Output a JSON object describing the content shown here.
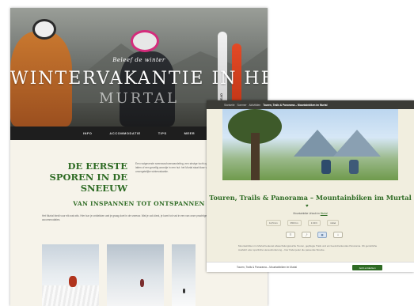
{
  "left_page": {
    "hero": {
      "tagline": "Beleef de winter",
      "title": "WINTERVAKANTIE IN HET",
      "subtitle": "MURTAL",
      "ski_brand": "HEAD"
    },
    "nav": [
      "INFO",
      "ACCOMMODATIE",
      "TIPS",
      "MEER"
    ],
    "headline": "DE EERSTE SPOREN IN DE SNEEUW",
    "headline_text": "Een rustgevende sneeuwschoenwandeling, een stevige tocht op de latten of een gezellig avondje in een hut: het Murtal staat klaar voor jouw onvergetelijke wintervakantie.",
    "section_title": "VAN INSPANNEN TOT ONTSPANNEN",
    "section_text": "Het Murtal biedt voor elk wat wils. Hier kun je ontdekken wat je graag doet in de sneeuw. Wat je ook kiest, je komt tot rust in een van onze prachtige accommodaties."
  },
  "right_page": {
    "breadcrumbs": [
      "Startseite",
      "Sommer",
      "Aktivitäten",
      "Touren, Trails & Panorama – Mountainbiken im Murtal"
    ],
    "title": "Touren, Trails & Panorama – Mountainbiken im Murtal",
    "meta_prefix": "Mountainbike Urlaub im",
    "meta_link": "Murtal",
    "stats": [
      "12,5 km",
      "350 hm",
      "1:30 h",
      "mittel"
    ],
    "tool_icons": [
      "☰",
      "⤴",
      "▦",
      "⇩"
    ],
    "description": "Mountainbiken im Murtal bedeutet abwechslungsreiche Touren, gepflegte Trails und ein beeindruckendes Panorama. Ob gemütliche Ausfahrt oder sportliche Herausforderung – hier findet jeder die passende Strecke.",
    "footer_text": "Touren, Trails & Panorama – Mountainbiken im Murtal",
    "footer_button": "Jetzt entdecken"
  }
}
